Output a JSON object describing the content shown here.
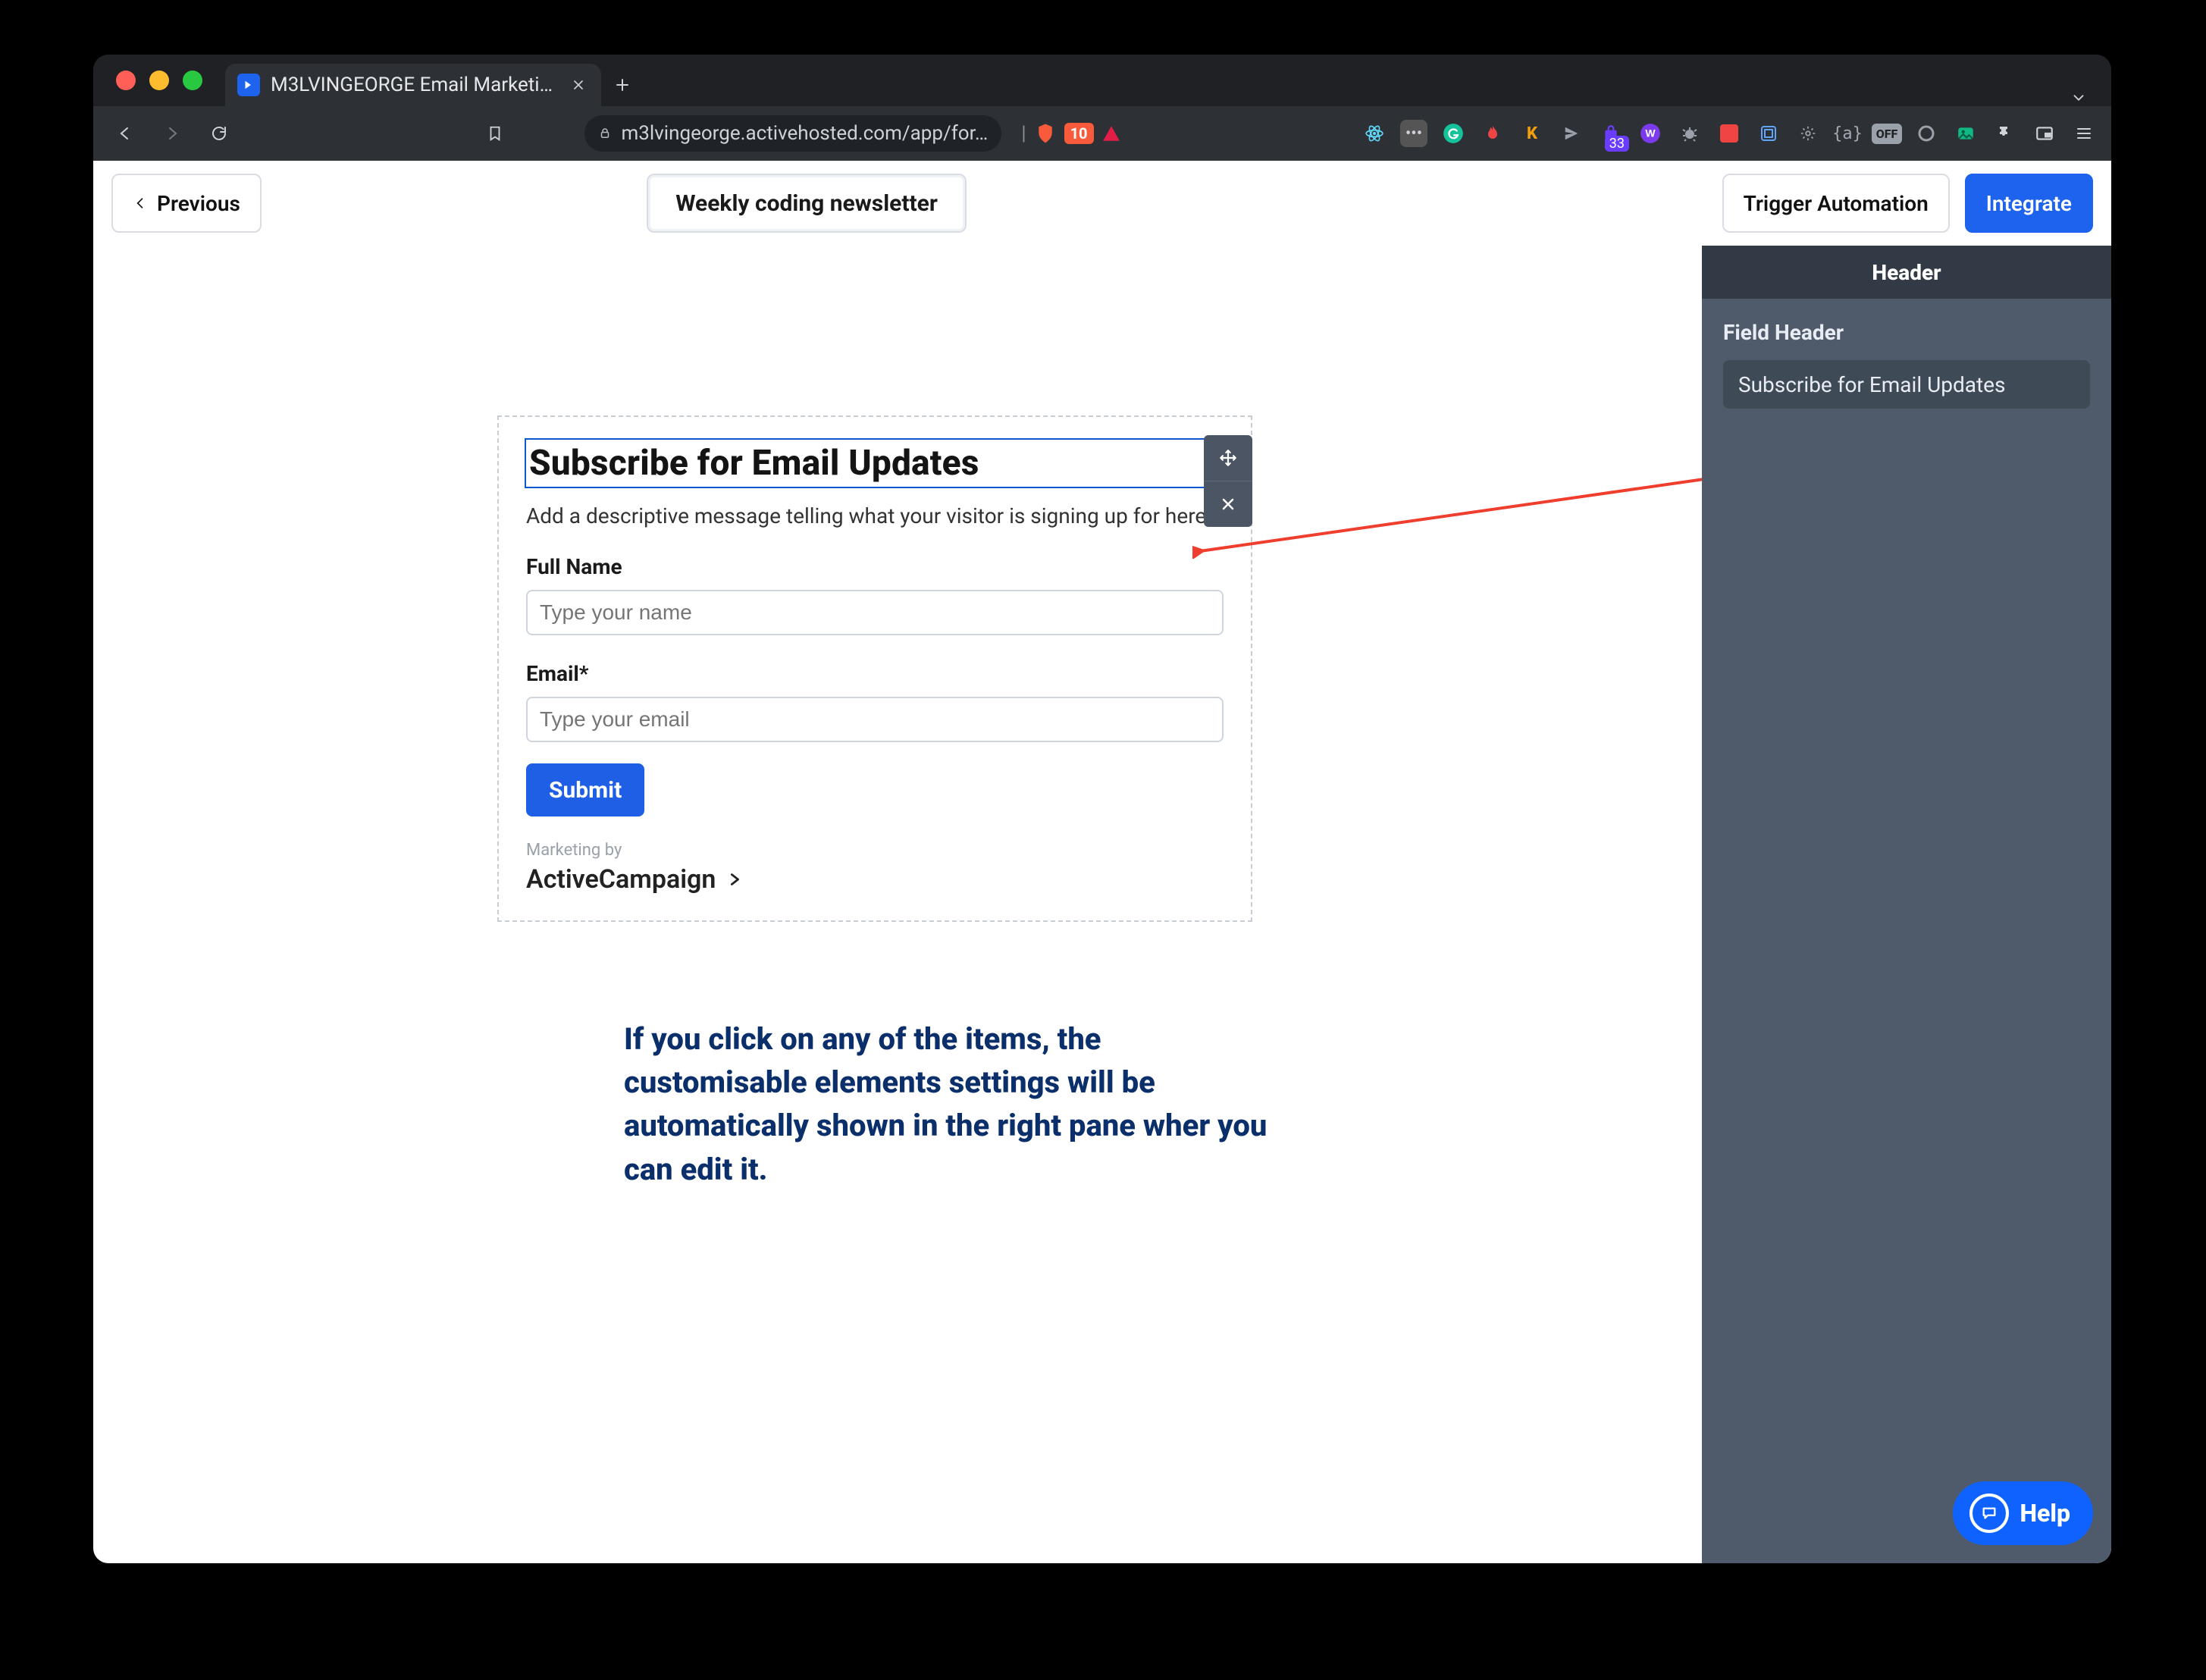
{
  "browser": {
    "tab_title": "M3LVINGEORGE Email Marketin…",
    "url_display": "m3lvingeorge.activehosted.com/app/for…",
    "shield_count": "10",
    "ext_badge": "33"
  },
  "appbar": {
    "previous_label": "Previous",
    "title_pill": "Weekly coding newsletter",
    "trigger_label": "Trigger Automation",
    "integrate_label": "Integrate"
  },
  "form": {
    "heading": "Subscribe for Email Updates",
    "description": "Add a descriptive message telling what your visitor is signing up for here.",
    "fullname_label": "Full Name",
    "fullname_placeholder": "Type your name",
    "email_label": "Email*",
    "email_placeholder": "Type your email",
    "submit_label": "Submit",
    "marketing_by": "Marketing by",
    "brand": "ActiveCampaign"
  },
  "panel": {
    "title": "Header",
    "sub": "Field Header",
    "input_value": "Subscribe for Email Updates"
  },
  "help_label": "Help",
  "annotation_text": "If you click on any of the items, the customisable elements settings will be automatically shown in the right pane wher you can edit it."
}
